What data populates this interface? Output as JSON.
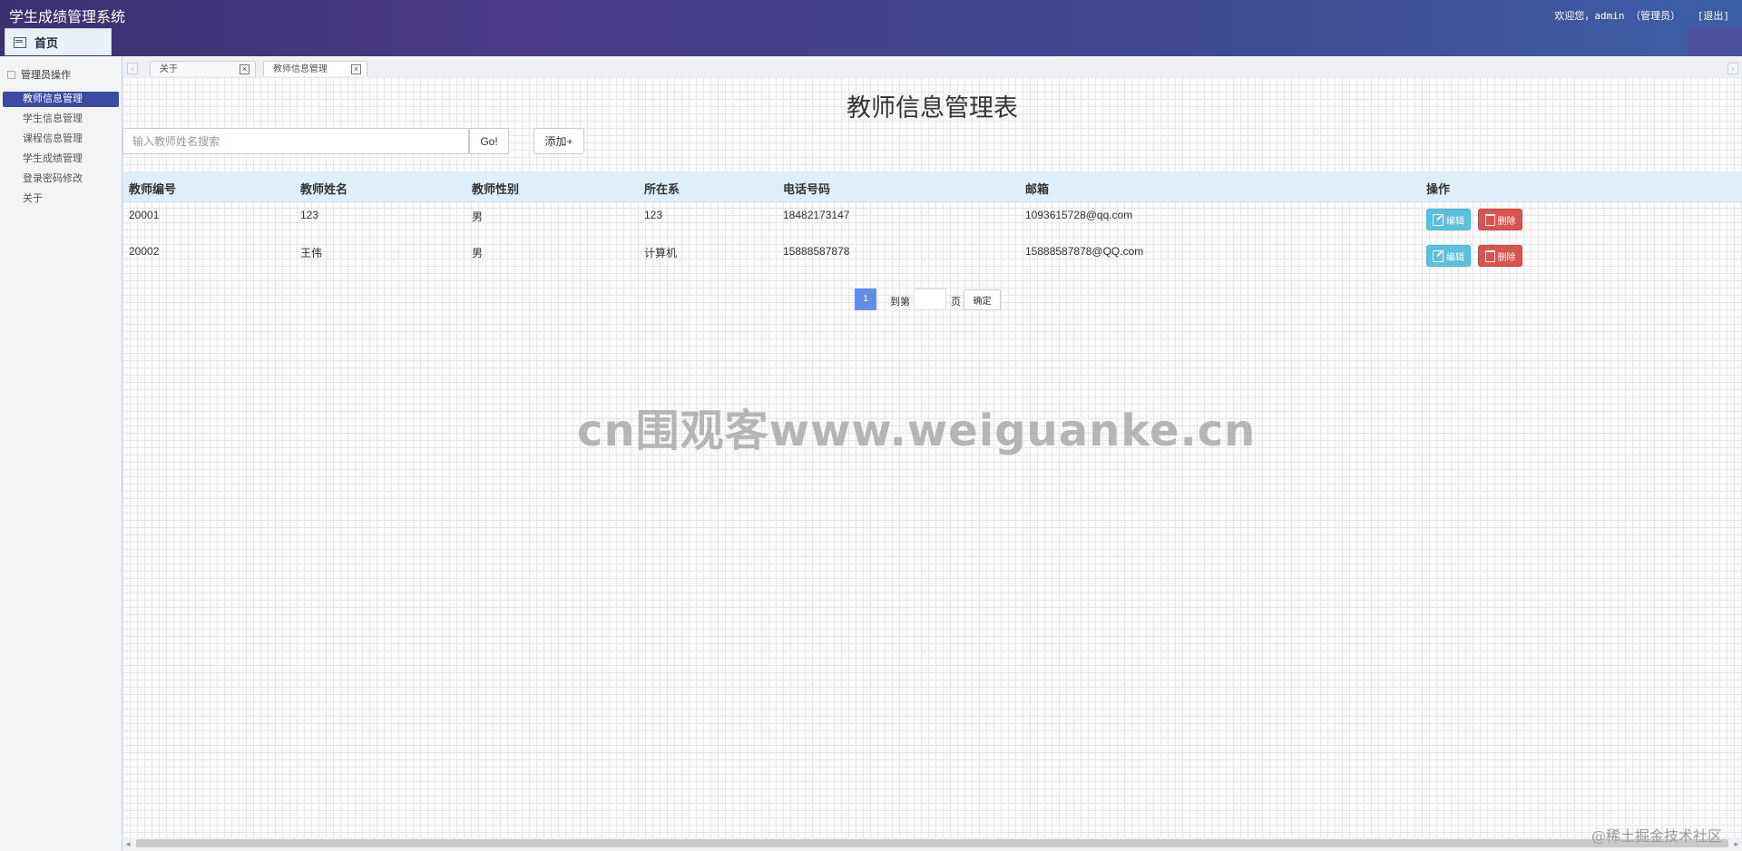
{
  "header": {
    "app_title": "学生成绩管理系统",
    "welcome": "欢迎您，admin （管理员）",
    "logout": "[退出]",
    "home_tab": "首页"
  },
  "sidebar": {
    "group_title": "管理员操作",
    "items": [
      {
        "label": "教师信息管理",
        "active": true
      },
      {
        "label": "学生信息管理",
        "active": false
      },
      {
        "label": "课程信息管理",
        "active": false
      },
      {
        "label": "学生成绩管理",
        "active": false
      },
      {
        "label": "登录密码修改",
        "active": false
      },
      {
        "label": "关于",
        "active": false
      }
    ]
  },
  "tabs": [
    {
      "label": "关于",
      "close": "×"
    },
    {
      "label": "教师信息管理",
      "close": "×"
    }
  ],
  "main": {
    "title": "教师信息管理表",
    "search_placeholder": "输入教师姓名搜索",
    "go_label": "Go!",
    "add_label": "添加+",
    "columns": [
      "教师编号",
      "教师姓名",
      "教师性别",
      "所在系",
      "电话号码",
      "邮箱",
      "操作"
    ],
    "rows": [
      {
        "id": "20001",
        "name": "123",
        "gender": "男",
        "dept": "123",
        "phone": "18482173147",
        "email": "1093615728@qq.com"
      },
      {
        "id": "20002",
        "name": "王伟",
        "gender": "男",
        "dept": "计算机",
        "phone": "15888587878",
        "email": "15888587878@QQ.com"
      }
    ],
    "edit_label": "编辑",
    "delete_label": "删除",
    "pager": {
      "current_page": "1",
      "goto_label": "到第",
      "page_unit": "页",
      "confirm_label": "确定"
    }
  },
  "watermark": "cn围观客www.weiguanke.cn",
  "corner_watermark": "@稀土掘金技术社区"
}
